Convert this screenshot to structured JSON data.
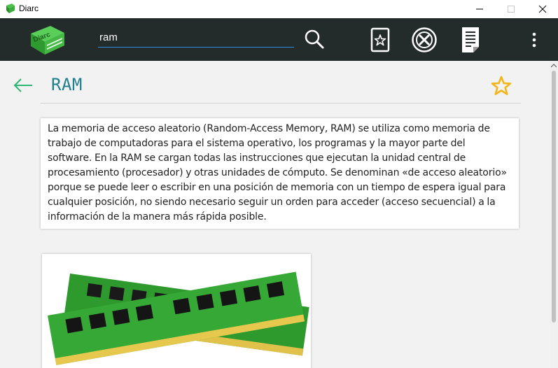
{
  "window": {
    "title": "Diarc"
  },
  "colors": {
    "toolbar": "#232b2b",
    "accent": "#1f7f8c",
    "star": "#f2b619",
    "pcb_green": "#2e9a2e"
  },
  "logo": {
    "text": "Diarc"
  },
  "search": {
    "value": "ram",
    "placeholder": ""
  },
  "icons": [
    "search-icon",
    "favorites-icon",
    "close-circle-icon",
    "history-icon",
    "more-vertical-icon",
    "back-arrow-icon",
    "star-icon"
  ],
  "entry": {
    "title": "RAM",
    "definition": "La memoria de acceso aleatorio (Random-Access Memory, RAM) se utiliza como memoria de trabajo de computadoras para el sistema operativo, los programas y la mayor parte del software. En la RAM se cargan todas las instrucciones que ejecutan la unidad central de procesamiento (procesador) y otras unidades de cómputo. Se denominan «de acceso aleatorio» porque se puede leer o escribir en una posición de memoria con un tiempo de espera igual para cualquier posición, no siendo necesario seguir un orden para acceder (acceso secuencial) a la información de la manera más rápida posible."
  }
}
